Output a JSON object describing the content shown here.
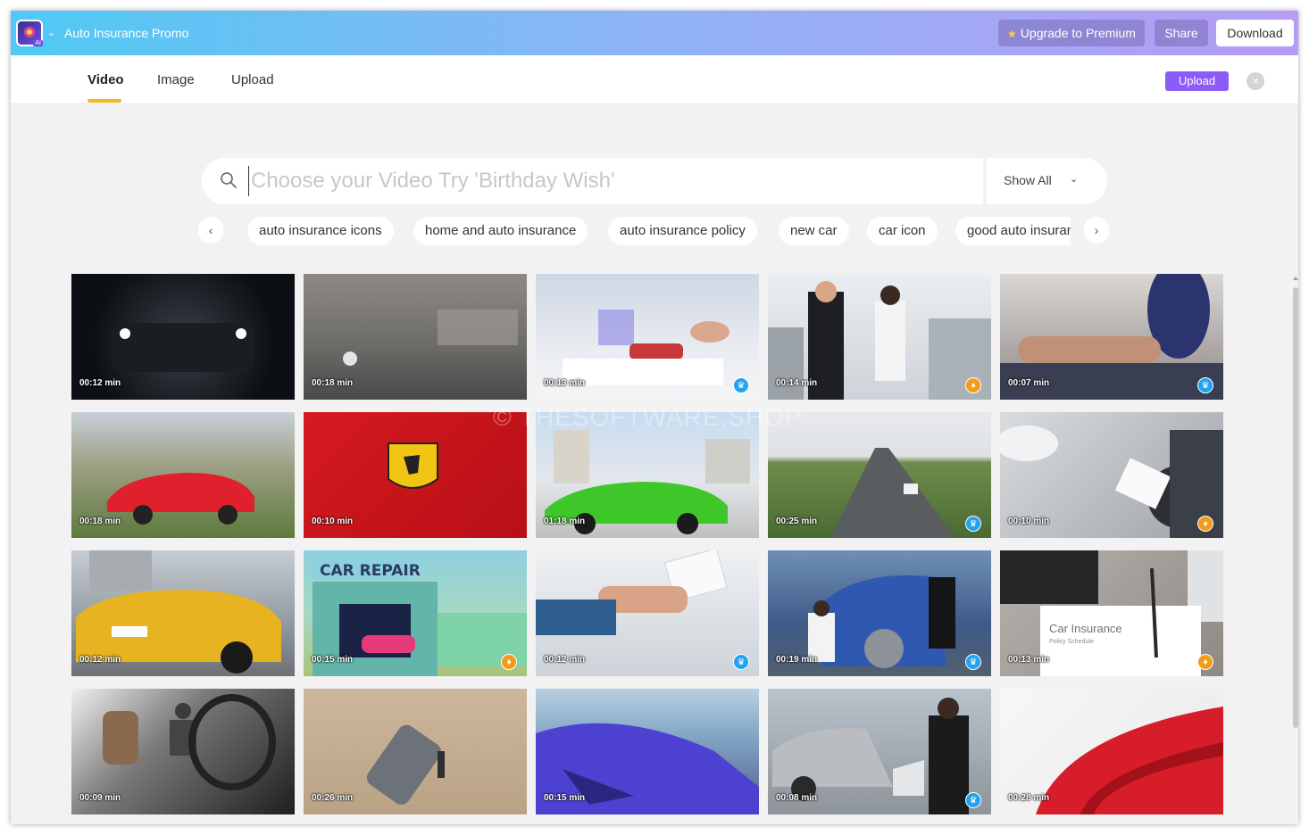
{
  "titlebar": {
    "title": "Auto Insurance Promo",
    "logo_badge": "AI",
    "upgrade_label": "Upgrade to Premium",
    "share_label": "Share",
    "download_label": "Download",
    "gradient_colors": [
      "#4fc9f4",
      "#b69cf5"
    ]
  },
  "tabs": {
    "items": [
      "Video",
      "Image",
      "Upload"
    ],
    "active": "Video",
    "upload_button": "Upload"
  },
  "search": {
    "placeholder": "Choose your Video Try 'Birthday Wish'",
    "value": "",
    "filter_label": "Show All"
  },
  "chips": [
    "auto insurance icons",
    "home and auto insurance",
    "auto insurance policy",
    "new car",
    "car icon",
    "good auto insurance"
  ],
  "videos": [
    {
      "duration": "00:12 min",
      "badge": ""
    },
    {
      "duration": "00:18 min",
      "badge": ""
    },
    {
      "duration": "00:13 min",
      "badge": "crown"
    },
    {
      "duration": "00:14 min",
      "badge": "diamond"
    },
    {
      "duration": "00:07 min",
      "badge": "crown"
    },
    {
      "duration": "00:18 min",
      "badge": ""
    },
    {
      "duration": "00:10 min",
      "badge": ""
    },
    {
      "duration": "01:18 min",
      "badge": ""
    },
    {
      "duration": "00:25 min",
      "badge": "crown"
    },
    {
      "duration": "00:10 min",
      "badge": "diamond"
    },
    {
      "duration": "00:12 min",
      "badge": ""
    },
    {
      "duration": "00:15 min",
      "badge": "diamond"
    },
    {
      "duration": "00:12 min",
      "badge": "crown"
    },
    {
      "duration": "00:19 min",
      "badge": "crown"
    },
    {
      "duration": "00:13 min",
      "badge": "diamond"
    },
    {
      "duration": "00:09 min",
      "badge": ""
    },
    {
      "duration": "00:26 min",
      "badge": ""
    },
    {
      "duration": "00:15 min",
      "badge": ""
    },
    {
      "duration": "00:08 min",
      "badge": "crown"
    },
    {
      "duration": "00:28 min",
      "badge": ""
    }
  ],
  "watermark": "© THESOFTWARE.SHOP"
}
